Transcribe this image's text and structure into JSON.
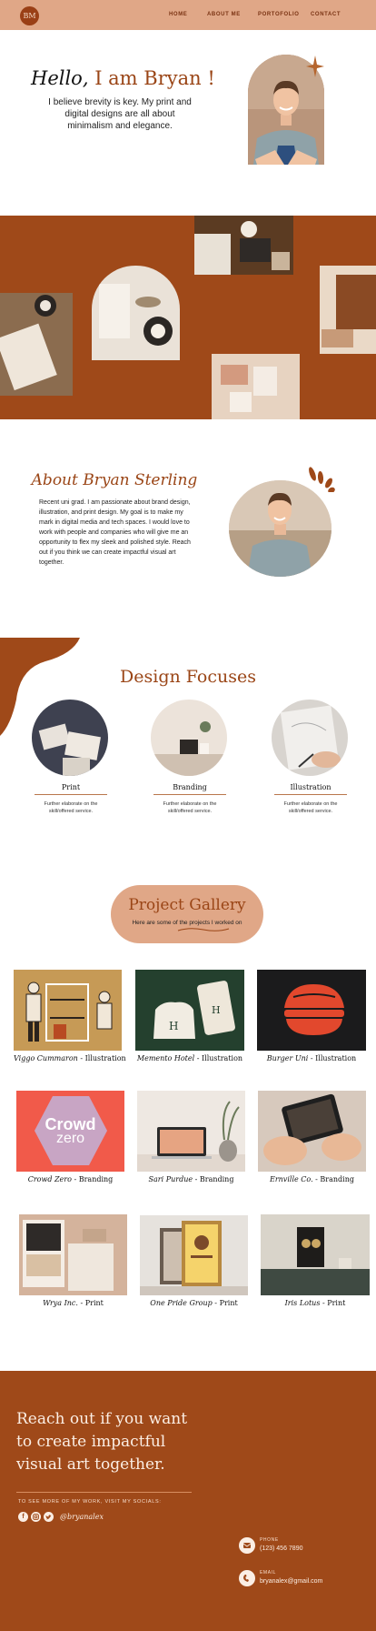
{
  "header": {
    "logo_text": "BM",
    "nav": [
      "HOME",
      "ABOUT ME",
      "PORTOFOLIO",
      "CONTACT"
    ]
  },
  "hero": {
    "greeting": "Hello,",
    "name": "I am Bryan !",
    "subtitle": "I believe brevity is key. My print and digital designs are all about minimalism and elegance."
  },
  "about": {
    "title": "About Bryan Sterling",
    "body": "Recent uni grad. I am passionate about brand design, illustration, and print design. My goal is to make my mark in digital media and tech spaces. I would love to work with people and companies who will give me an opportunity to flex my sleek and polished style. Reach out if you think we can create impactful visual art together."
  },
  "focuses": {
    "title": "Design Focuses",
    "items": [
      {
        "label": "Print",
        "desc": "Further elaborate on the skill/offered service."
      },
      {
        "label": "Branding",
        "desc": "Further elaborate on the skill/offered service."
      },
      {
        "label": "Illustration",
        "desc": "Further elaborate on the skill/offered service."
      }
    ]
  },
  "gallery": {
    "title": "Project Gallery",
    "subtitle": "Here are some of the projects I worked on",
    "projects": [
      {
        "client": "Viggo Cummaron",
        "category": "Illustration"
      },
      {
        "client": "Memento Hotel",
        "category": "Illustration"
      },
      {
        "client": "Burger Uni",
        "category": "Illustration"
      },
      {
        "client": "Crowd Zero",
        "category": "Branding"
      },
      {
        "client": "Sari Purdue",
        "category": "Branding"
      },
      {
        "client": "Ernville Co.",
        "category": "Branding"
      },
      {
        "client": "Wrya Inc.",
        "category": "Print"
      },
      {
        "client": "One Pride Group",
        "category": "Print"
      },
      {
        "client": "Iris Lotus",
        "category": "Print"
      }
    ],
    "crowd_zero_logo": [
      "Crowd",
      "zero"
    ]
  },
  "footer": {
    "headline_lines": [
      "Reach out if you want",
      "to create impactful",
      "visual art together."
    ],
    "socials_label": "TO SEE MORE OF MY WORK, VISIT MY SOCIALS:",
    "handle": "@bryanalex",
    "phone_label": "PHONE",
    "phone_value": "(123) 456 7890",
    "email_label": "EMAIL",
    "email_value": "bryanalex@gmail.com"
  },
  "colors": {
    "header_bg": "#e0a787",
    "accent_brown": "#9f4919",
    "title_brown": "#9a4516"
  }
}
